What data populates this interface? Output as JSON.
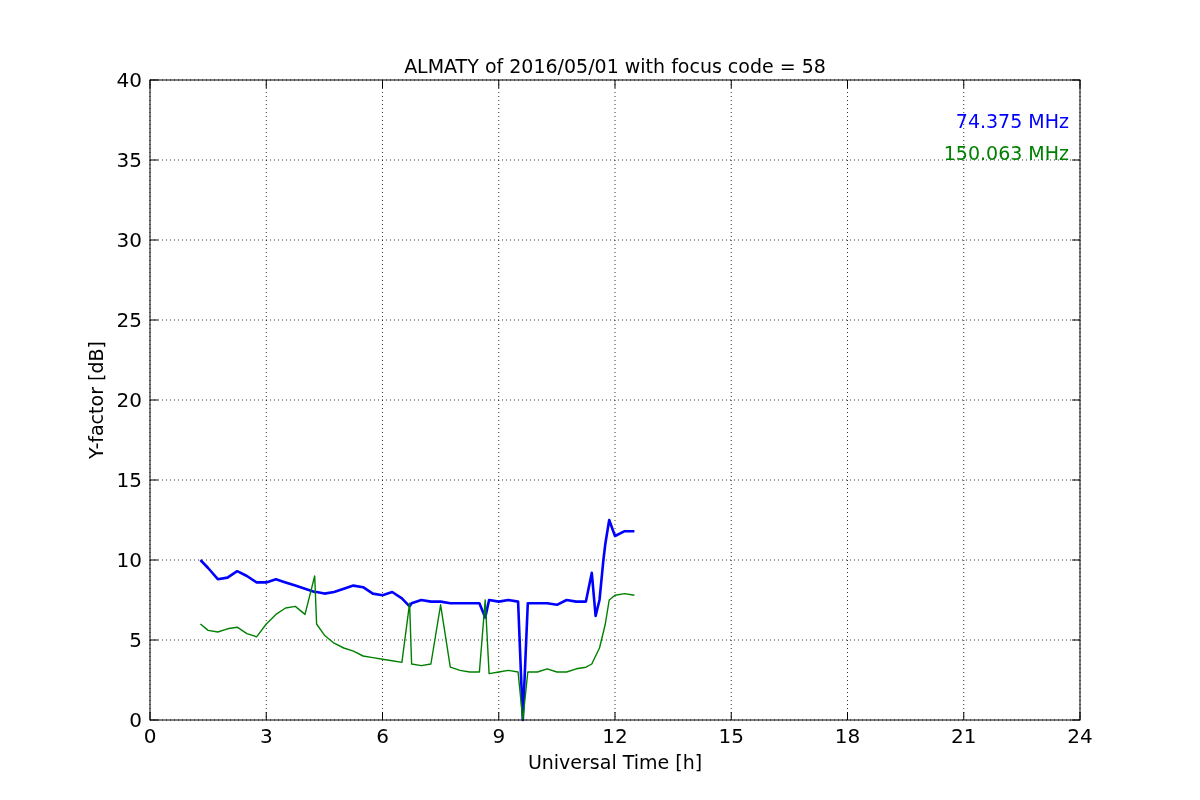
{
  "chart": {
    "chart_data": {
      "type": "line",
      "title": "ALMATY of 2016/05/01 with focus code = 58",
      "xlabel": "Universal Time [h]",
      "ylabel": "Y-factor [dB]",
      "x": [
        1.3,
        1.5,
        1.75,
        2.0,
        2.25,
        2.5,
        2.75,
        3.0,
        3.25,
        3.5,
        3.75,
        4.0,
        4.25,
        4.3,
        4.5,
        4.75,
        5.0,
        5.25,
        5.5,
        5.75,
        6.0,
        6.25,
        6.5,
        6.7,
        6.75,
        7.0,
        7.25,
        7.5,
        7.75,
        8.0,
        8.25,
        8.5,
        8.65,
        8.75,
        9.0,
        9.25,
        9.5,
        9.62,
        9.75,
        10.0,
        10.25,
        10.5,
        10.75,
        11.0,
        11.25,
        11.4,
        11.5,
        11.6,
        11.7,
        11.75,
        11.85,
        12.0,
        12.25,
        12.5
      ],
      "series": [
        {
          "name": "74.375 MHz",
          "color": "#0000ff",
          "values": [
            10.0,
            9.5,
            8.8,
            8.9,
            9.3,
            9.0,
            8.6,
            8.6,
            8.8,
            8.6,
            8.4,
            8.2,
            8.0,
            8.0,
            7.9,
            8.0,
            8.2,
            8.4,
            8.3,
            7.9,
            7.8,
            8.0,
            7.6,
            7.1,
            7.3,
            7.5,
            7.4,
            7.4,
            7.3,
            7.3,
            7.3,
            7.3,
            6.4,
            7.5,
            7.4,
            7.5,
            7.4,
            0,
            7.3,
            7.3,
            7.3,
            7.2,
            7.5,
            7.4,
            7.4,
            9.2,
            6.5,
            7.5,
            10.0,
            11.0,
            12.5,
            11.5,
            11.8,
            11.8
          ]
        },
        {
          "name": "150.063 MHz",
          "color": "#008000",
          "values": [
            6.0,
            5.6,
            5.5,
            5.7,
            5.8,
            5.4,
            5.2,
            6.0,
            6.6,
            7.0,
            7.1,
            6.6,
            9.0,
            6.0,
            5.3,
            4.8,
            4.5,
            4.3,
            4.0,
            3.9,
            3.8,
            3.7,
            3.6,
            7.3,
            3.5,
            3.4,
            3.5,
            7.2,
            3.3,
            3.1,
            3.0,
            3.0,
            7.5,
            2.9,
            3.0,
            3.1,
            3.0,
            0,
            3.0,
            3.0,
            3.2,
            3.0,
            3.0,
            3.2,
            3.3,
            3.5,
            4.0,
            4.5,
            5.5,
            6.0,
            7.5,
            7.8,
            7.9,
            7.8
          ]
        }
      ],
      "xlim": [
        0,
        24
      ],
      "ylim": [
        0,
        40
      ],
      "xticks": [
        0,
        3,
        6,
        9,
        12,
        15,
        18,
        21,
        24
      ],
      "yticks": [
        0,
        5,
        10,
        15,
        20,
        25,
        30,
        35,
        40
      ],
      "grid": true
    }
  }
}
